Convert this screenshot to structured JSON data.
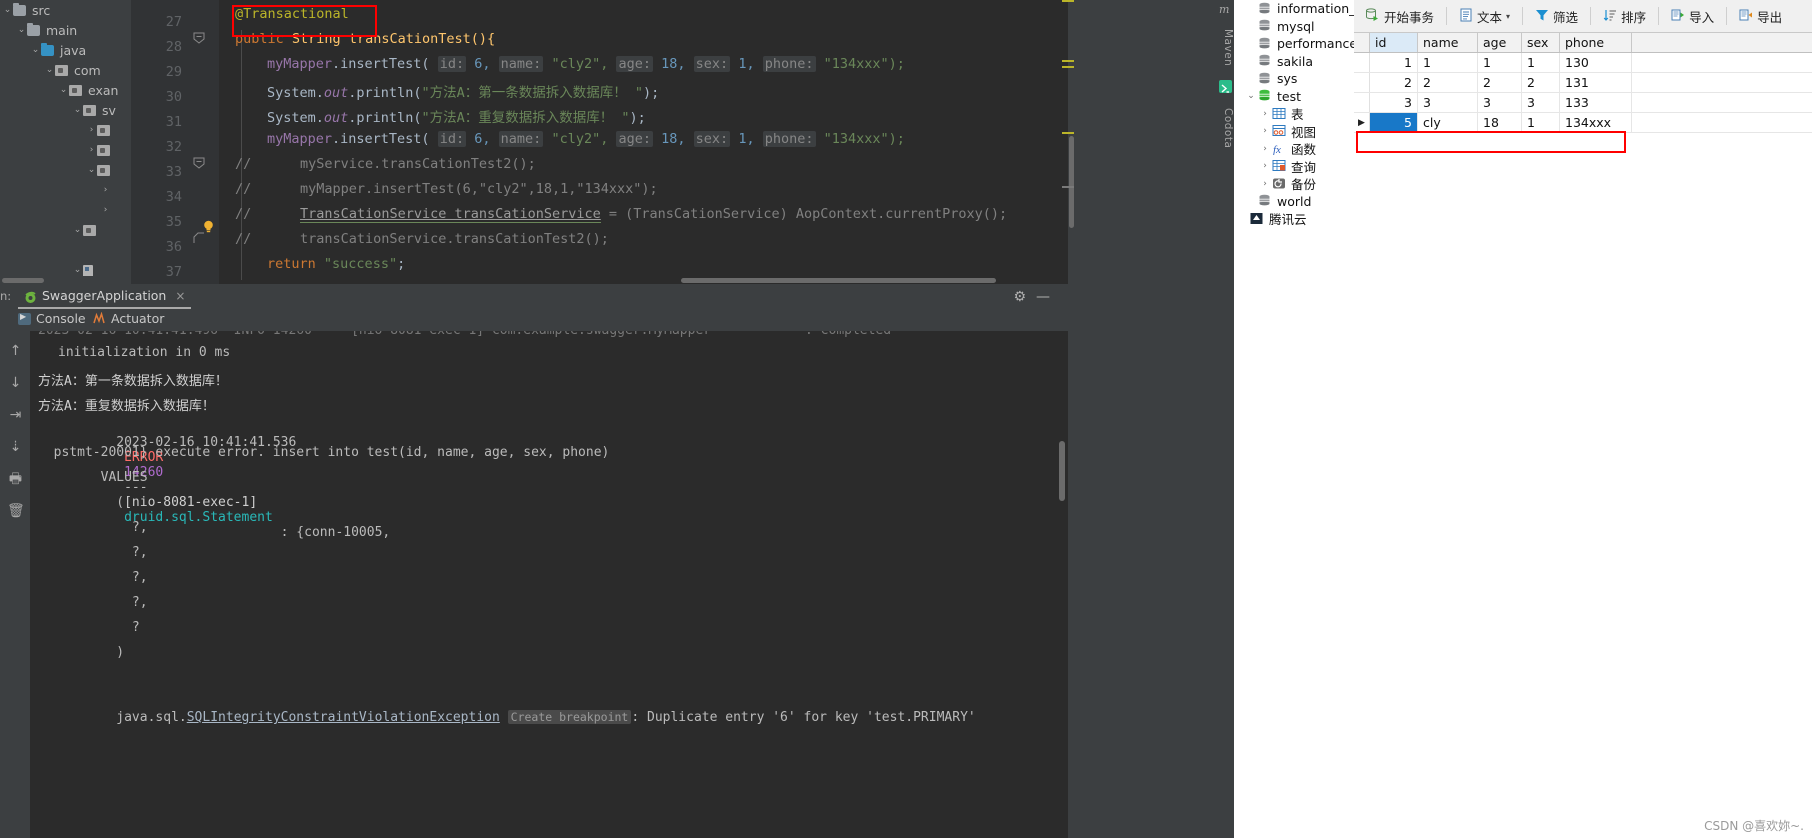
{
  "ide": {
    "project_tree": [
      {
        "label": "src",
        "arrow": "v",
        "icon": "folder",
        "indent": 0
      },
      {
        "label": "main",
        "arrow": "v",
        "icon": "folder",
        "indent": 1
      },
      {
        "label": "java",
        "arrow": "v",
        "icon": "folder-blue",
        "indent": 2
      },
      {
        "label": "com",
        "arrow": "v",
        "icon": "package",
        "indent": 3
      },
      {
        "label": "exan",
        "arrow": "v",
        "icon": "package",
        "indent": 4
      },
      {
        "label": "sv",
        "arrow": "v",
        "icon": "package",
        "indent": 5
      },
      {
        "label": "",
        "arrow": ">",
        "icon": "package",
        "indent": 6
      },
      {
        "label": "",
        "arrow": ">",
        "icon": "package",
        "indent": 6
      },
      {
        "label": "",
        "arrow": "v",
        "icon": "package",
        "indent": 6
      },
      {
        "label": "",
        "arrow": ">",
        "icon": "",
        "indent": 7
      },
      {
        "label": "",
        "arrow": ">",
        "icon": "",
        "indent": 7
      },
      {
        "label": "",
        "arrow": "v",
        "icon": "package",
        "indent": 5
      },
      {
        "label": "",
        "arrow": "",
        "icon": "",
        "indent": 6
      },
      {
        "label": "",
        "arrow": "v",
        "icon": "file",
        "indent": 5
      }
    ],
    "editor": {
      "line_numbers": [
        "27",
        "28",
        "29",
        "30",
        "31",
        "32",
        "33",
        "34",
        "35",
        "36",
        "37"
      ],
      "annotation_highlight": "@Transactional",
      "lines": [
        "@Transactional",
        "public String transCationTest(){",
        "myMapper.insertTest( id: 6, name: \"cly2\", age: 18, sex: 1, phone: \"134xxx\");",
        "System.out.println(\"方法A：第一条数据拆入数据库！ \");",
        "System.out.println(\"方法A：重复数据拆入数据库！ \");",
        "myMapper.insertTest( id: 6, name: \"cly2\", age: 18, sex: 1, phone: \"134xxx\");",
        "//    myService.transCationTest2();",
        "//    myMapper.insertTest(6,\"cly2\",18,1,\"134xxx\");",
        "//    TransCationService transCationService = (TransCationService) AopContext.currentProxy();",
        "//    transCationService.transCationTest2();",
        "return \"success\";"
      ],
      "tokens": {
        "annotation": "@Transactional",
        "kw_public": "public",
        "type_String": "String",
        "method_name": "transCationTest(){",
        "mapper": "myMapper",
        "insert_call": ".insertTest(",
        "hint_id": "id:",
        "hint_name": "name:",
        "hint_age": "age:",
        "hint_sex": "sex:",
        "hint_phone": "phone:",
        "val_id": "6,",
        "val_name": "\"cly2\",",
        "val_age": "18,",
        "val_sex": "1,",
        "val_phone": "\"134xxx\");",
        "system": "System.",
        "out": "out",
        "println": ".println(",
        "str_a1": "\"方法A：第一条数据拆入数据库！ \"",
        "str_a2": "\"方法A：重复数据拆入数据库！ \"",
        "semi": ");",
        "cmt_slashes": "//",
        "cmt_service_call": "myService.transCationTest2();",
        "cmt_mapper_call": "myMapper.insertTest(6,\"cly2\",18,1,\"134xxx\");",
        "cmt_decl_a": "TransCationService transCationService",
        "cmt_decl_b": " = (TransCationService) AopContext.currentProxy();",
        "cmt_proxy_call": "transCationService.transCationTest2();",
        "kw_return": "return",
        "str_success": "\"success\"",
        "semi2": ";"
      }
    },
    "tool_strip": [
      {
        "label": "Maven",
        "icon": "maven-icon"
      },
      {
        "label": "Codota",
        "icon": "codota-icon"
      }
    ],
    "run_panel": {
      "run_label": "n:",
      "tab_name": "SwaggerApplication",
      "tab_close": "×",
      "gear": "⚙",
      "minimize": "—",
      "sub_tabs": [
        {
          "label": "Console",
          "icon": "console-icon"
        },
        {
          "label": "Actuator",
          "icon": "actuator-icon"
        }
      ],
      "side_buttons": [
        "↑",
        "↓",
        "⇥",
        "⇣",
        "🖶",
        "🗑"
      ],
      "console_lines": [
        {
          "text": "initialization in 0 ms",
          "color": "#bbbbbb",
          "indent": 20
        },
        {
          "text": "方法A：第一条数据拆入数据库！",
          "color": "#cfcfcf",
          "indent": 8
        },
        {
          "text": "方法A：重复数据拆入数据库！",
          "color": "#cfcfcf",
          "indent": 8
        },
        {
          "text": "  pstmt-20001} execute error. insert into test(id, name, age, sex, phone)",
          "color": "#bbbbbb",
          "indent": 8
        },
        {
          "text": "        VALUES",
          "color": "#bbbbbb",
          "indent": 8
        },
        {
          "text": "          (",
          "color": "#bbbbbb",
          "indent": 8
        },
        {
          "text": "            ?,",
          "color": "#bbbbbb",
          "indent": 8
        },
        {
          "text": "            ?,",
          "color": "#bbbbbb",
          "indent": 8
        },
        {
          "text": "            ?,",
          "color": "#bbbbbb",
          "indent": 8
        },
        {
          "text": "            ?,",
          "color": "#bbbbbb",
          "indent": 8
        },
        {
          "text": "            ?",
          "color": "#bbbbbb",
          "indent": 8
        },
        {
          "text": "          )",
          "color": "#bbbbbb",
          "indent": 8
        }
      ],
      "error_line": {
        "timestamp": "2023-02-16 10:41:41.536",
        "level": "ERROR",
        "pid": "14260",
        "dashes": "---",
        "thread": "[nio-8081-exec-1]",
        "logger": "druid.sql.Statement",
        "colon": ": {conn-10005,"
      },
      "exception_line": {
        "prefix": "java.sql.",
        "link": "SQLIntegrityConstraintViolationException",
        "breakpoint": "Create breakpoint",
        "message": ": Duplicate entry '6' for key 'test.PRIMARY'"
      }
    }
  },
  "navicat": {
    "tree": [
      {
        "label": "information_sc",
        "arrow": "",
        "icon": "db-gray",
        "indent": 0
      },
      {
        "label": "mysql",
        "arrow": "",
        "icon": "db-gray",
        "indent": 0
      },
      {
        "label": "performance_s",
        "arrow": "",
        "icon": "db-gray",
        "indent": 0
      },
      {
        "label": "sakila",
        "arrow": "",
        "icon": "db-gray",
        "indent": 0
      },
      {
        "label": "sys",
        "arrow": "",
        "icon": "db-gray",
        "indent": 0
      },
      {
        "label": "test",
        "arrow": "v",
        "icon": "db-green",
        "indent": 0
      },
      {
        "label": "表",
        "arrow": ">",
        "icon": "table",
        "indent": 1
      },
      {
        "label": "视图",
        "arrow": ">",
        "icon": "view",
        "indent": 1
      },
      {
        "label": "函数",
        "arrow": ">",
        "icon": "function",
        "indent": 1
      },
      {
        "label": "查询",
        "arrow": ">",
        "icon": "query",
        "indent": 1
      },
      {
        "label": "备份",
        "arrow": ">",
        "icon": "backup",
        "indent": 1
      },
      {
        "label": "world",
        "arrow": "",
        "icon": "db-gray",
        "indent": 0
      },
      {
        "label": "腾讯云",
        "arrow": "",
        "icon": "cloud",
        "indent": -1
      }
    ],
    "toolbar": [
      {
        "label": "开始事务",
        "icon": "transaction-icon",
        "caret": false
      },
      {
        "label": "文本",
        "icon": "text-icon",
        "caret": true
      },
      {
        "label": "筛选",
        "icon": "filter-icon",
        "caret": false
      },
      {
        "label": "排序",
        "icon": "sort-icon",
        "caret": false
      },
      {
        "label": "导入",
        "icon": "import-icon",
        "caret": false
      },
      {
        "label": "导出",
        "icon": "export-icon",
        "caret": false
      }
    ],
    "grid": {
      "columns": [
        "id",
        "name",
        "age",
        "sex",
        "phone"
      ],
      "active_column": "id",
      "rows": [
        {
          "id": "1",
          "name": "1",
          "age": "1",
          "sex": "1",
          "phone": "130",
          "selected": false
        },
        {
          "id": "2",
          "name": "2",
          "age": "2",
          "sex": "2",
          "phone": "131",
          "selected": false
        },
        {
          "id": "3",
          "name": "3",
          "age": "3",
          "sex": "3",
          "phone": "133",
          "selected": false
        },
        {
          "id": "5",
          "name": "cly",
          "age": "18",
          "sex": "1",
          "phone": "134xxx",
          "selected": true
        }
      ]
    }
  },
  "watermark": "CSDN @喜欢妳~."
}
